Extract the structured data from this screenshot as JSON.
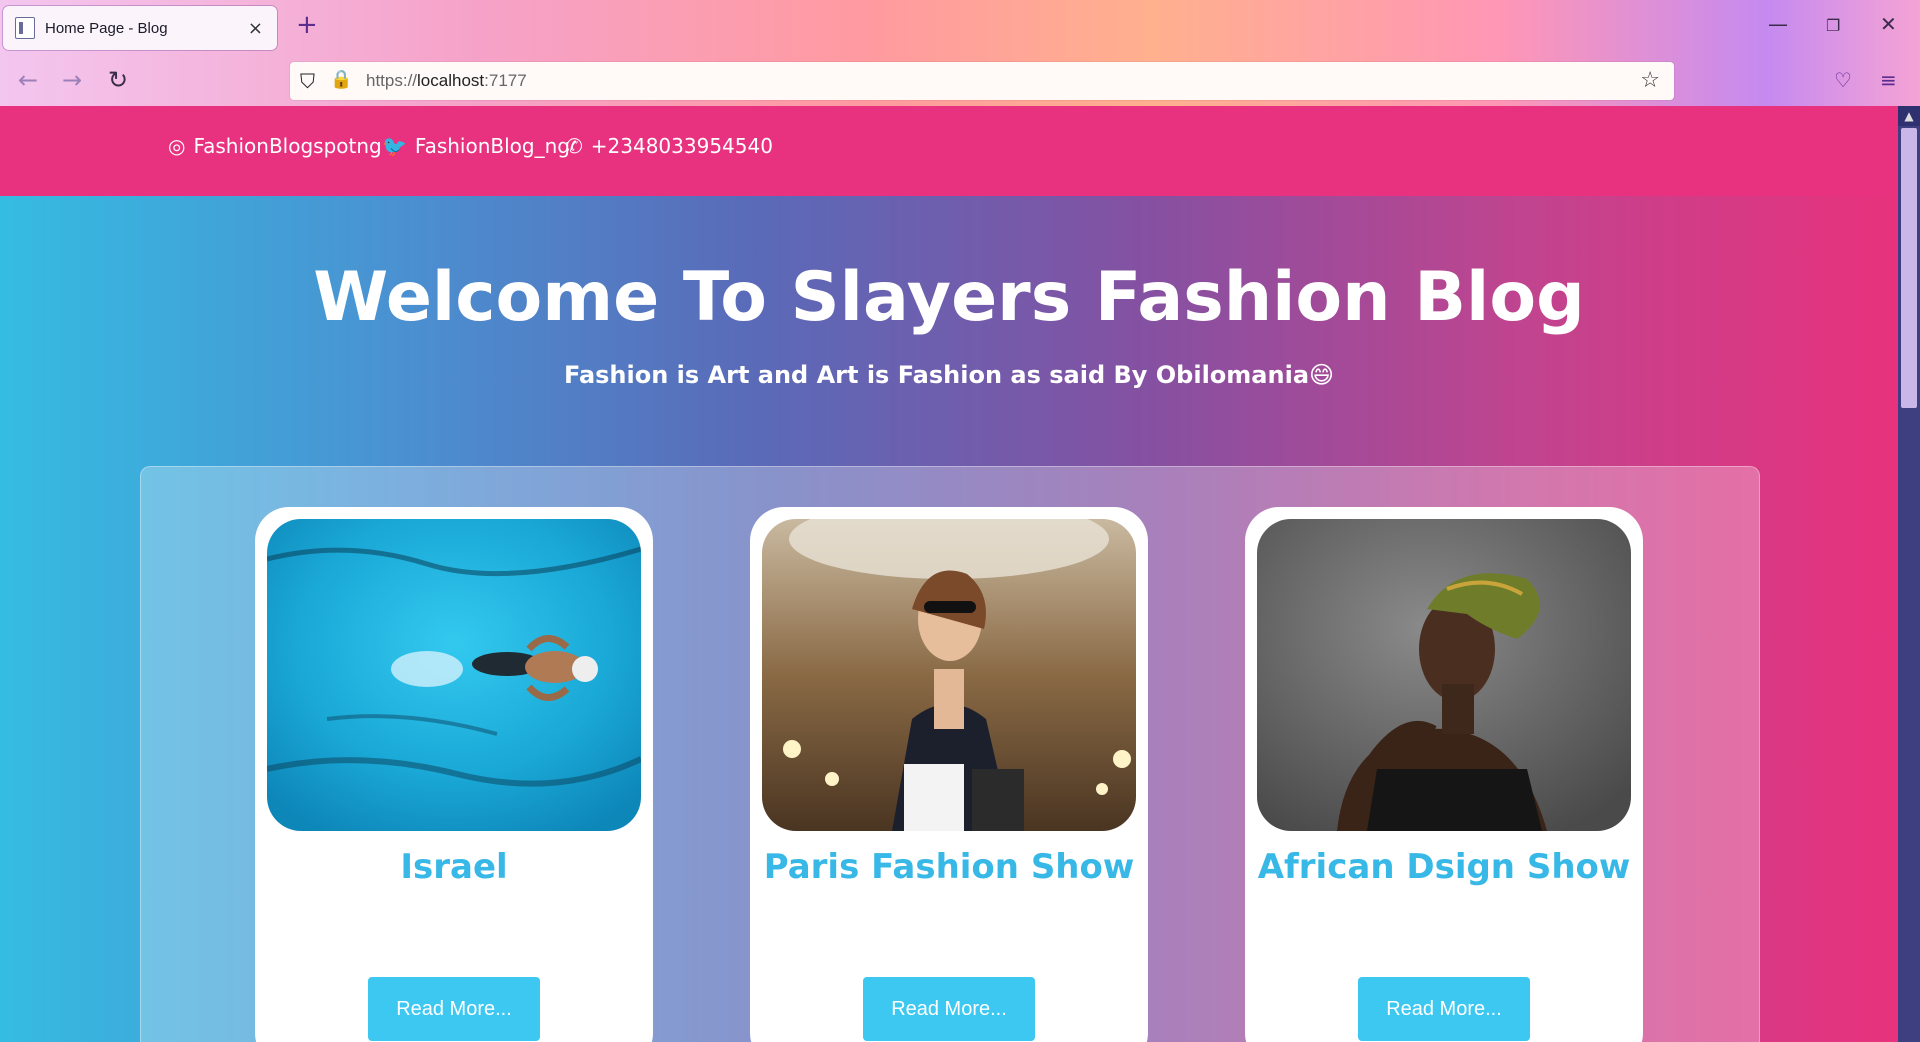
{
  "browser": {
    "tab_title": "Home Page - Blog",
    "tab_close": "×",
    "new_tab": "+",
    "url_prefix": "https://",
    "url_host": "localhost",
    "url_port": ":7177"
  },
  "topbar": {
    "instagram": "FashionBlogspotng",
    "twitter": "FashionBlog_ng",
    "phone": "+2348033954540"
  },
  "hero": {
    "title": "Welcome To Slayers Fashion Blog",
    "tagline": "Fashion is Art and Art is Fashion as said By Obilomania😄"
  },
  "cards": [
    {
      "title": "Israel",
      "button": "Read More..."
    },
    {
      "title": "Paris Fashion Show",
      "button": "Read More..."
    },
    {
      "title": "African Dsign Show",
      "button": "Read More..."
    }
  ],
  "colors": {
    "topbar": "#e8317f",
    "accent": "#37b8e6",
    "button": "#3cc8f1"
  }
}
